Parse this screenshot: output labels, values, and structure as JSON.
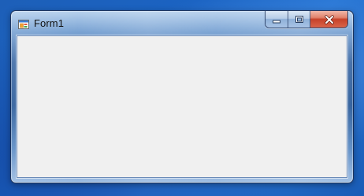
{
  "window": {
    "title": "Form1",
    "icon": "form-app-icon"
  },
  "caption_buttons": {
    "minimize_icon": "minimize-icon",
    "maximize_icon": "maximize-icon",
    "close_icon": "close-icon"
  },
  "colors": {
    "desktop": "#1b63c2",
    "client_area": "#f0f0f0",
    "close_button": "#c7432a"
  }
}
